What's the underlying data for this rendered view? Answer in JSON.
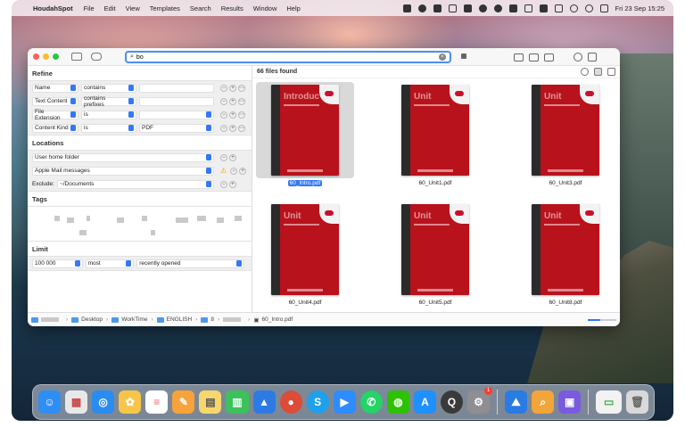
{
  "menubar": {
    "app_name": "HoudahSpot",
    "items": [
      "File",
      "Edit",
      "View",
      "Templates",
      "Search",
      "Results",
      "Window",
      "Help"
    ],
    "clock": "Fri 23 Sep 15:25",
    "status_icons": [
      "photos-icon",
      "drop-icon",
      "stop-icon",
      "p-icon",
      "bear-icon",
      "leaf-icon",
      "record-icon",
      "bluetooth-icon",
      "control-icon",
      "a-icon",
      "battery-icon",
      "wifi-icon",
      "play-icon",
      "screen-icon"
    ]
  },
  "window": {
    "search": {
      "query": "bo",
      "placeholder": ""
    },
    "refine": {
      "heading": "Refine",
      "criteria": [
        {
          "attribute": "Name",
          "operator": "contains",
          "value": ""
        },
        {
          "attribute": "Text Content",
          "operator": "contains prefixes",
          "value": ""
        },
        {
          "attribute": "File Extension",
          "operator": "is",
          "value": ""
        },
        {
          "attribute": "Content Kind",
          "operator": "is",
          "value": "PDF"
        }
      ]
    },
    "locations": {
      "heading": "Locations",
      "items": [
        {
          "label": "User home folder",
          "warning": false
        },
        {
          "label": "Apple Mail messages",
          "warning": true
        }
      ],
      "exclude_label": "Exclude:",
      "exclude_value": "~/Documents"
    },
    "tags": {
      "heading": "Tags"
    },
    "limit": {
      "heading": "Limit",
      "count": "100 000",
      "mode": "most",
      "order": "recently opened"
    },
    "results": {
      "count_label": "66 files found",
      "files": [
        {
          "name": "60_Intro.pdf",
          "cover_title": "Introduc",
          "selected": true
        },
        {
          "name": "60_Unit1.pdf",
          "cover_title": "Unit",
          "selected": false
        },
        {
          "name": "60_Unit3.pdf",
          "cover_title": "Unit",
          "selected": false
        },
        {
          "name": "60_Unit4.pdf",
          "cover_title": "Unit",
          "selected": false
        },
        {
          "name": "60_Unit5.pdf",
          "cover_title": "Unit",
          "selected": false
        },
        {
          "name": "60_Unit8.pdf",
          "cover_title": "Unit",
          "selected": false
        }
      ]
    },
    "pathbar": {
      "crumbs": [
        "Desktop",
        "WorkTime",
        "ENGLISH",
        "8"
      ],
      "file": "60_Intro.pdf"
    }
  },
  "dock": {
    "apps": [
      {
        "name": "finder-icon",
        "color": "#2f8ef4"
      },
      {
        "name": "launchpad-icon",
        "color": "#e8e8e8"
      },
      {
        "name": "safari-icon",
        "color": "#2a8cf0"
      },
      {
        "name": "photos-icon",
        "color": "#f6c54a"
      },
      {
        "name": "reminders-icon",
        "color": "#ffffff"
      },
      {
        "name": "pages-icon",
        "color": "#f7a23a"
      },
      {
        "name": "notes-icon",
        "color": "#f5d76e"
      },
      {
        "name": "numbers-icon",
        "color": "#3cc25a"
      },
      {
        "name": "keynote-icon",
        "color": "#2c7be5"
      },
      {
        "name": "chrome-icon",
        "color": "#dd4b39"
      },
      {
        "name": "skype-icon",
        "color": "#1fa0ea"
      },
      {
        "name": "zoom-icon",
        "color": "#2d8cff"
      },
      {
        "name": "whatsapp-icon",
        "color": "#25d366"
      },
      {
        "name": "wechat-icon",
        "color": "#2dc100"
      },
      {
        "name": "app-store-icon",
        "color": "#1e90ff"
      },
      {
        "name": "quicktime-icon",
        "color": "#3a3a3a"
      },
      {
        "name": "system-preferences-icon",
        "color": "#8e8e93",
        "badge": "1"
      },
      {
        "name": "maps-icon",
        "color": "#2a7be4"
      },
      {
        "name": "houdahspot-icon",
        "color": "#f2a53a"
      },
      {
        "name": "screenshot-icon",
        "color": "#7a5ae0"
      },
      {
        "name": "chrome-window-icon",
        "color": "#f2f2f2"
      },
      {
        "name": "trash-icon",
        "color": "#d9d9d9"
      }
    ]
  }
}
